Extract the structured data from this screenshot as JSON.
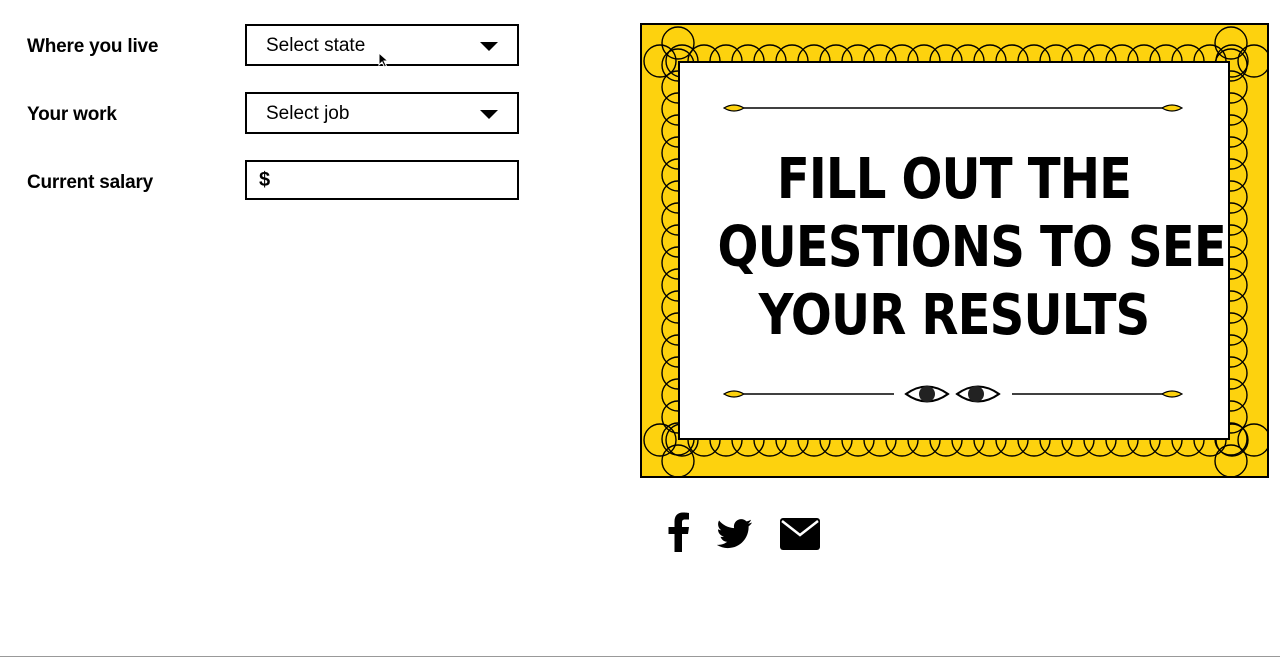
{
  "form": {
    "location": {
      "label": "Where you live",
      "value": "Select state"
    },
    "job": {
      "label": "Your work",
      "value": "Select job"
    },
    "salary": {
      "label": "Current salary",
      "currency": "$",
      "value": ""
    }
  },
  "card": {
    "headline_lines": [
      "FILL OUT THE",
      "QUESTIONS TO SEE",
      "YOUR RESULTS"
    ],
    "frame_color": "#FDD20E",
    "line_color": "#000000"
  },
  "share": {
    "icons": [
      "facebook-icon",
      "twitter-icon",
      "email-icon"
    ]
  }
}
